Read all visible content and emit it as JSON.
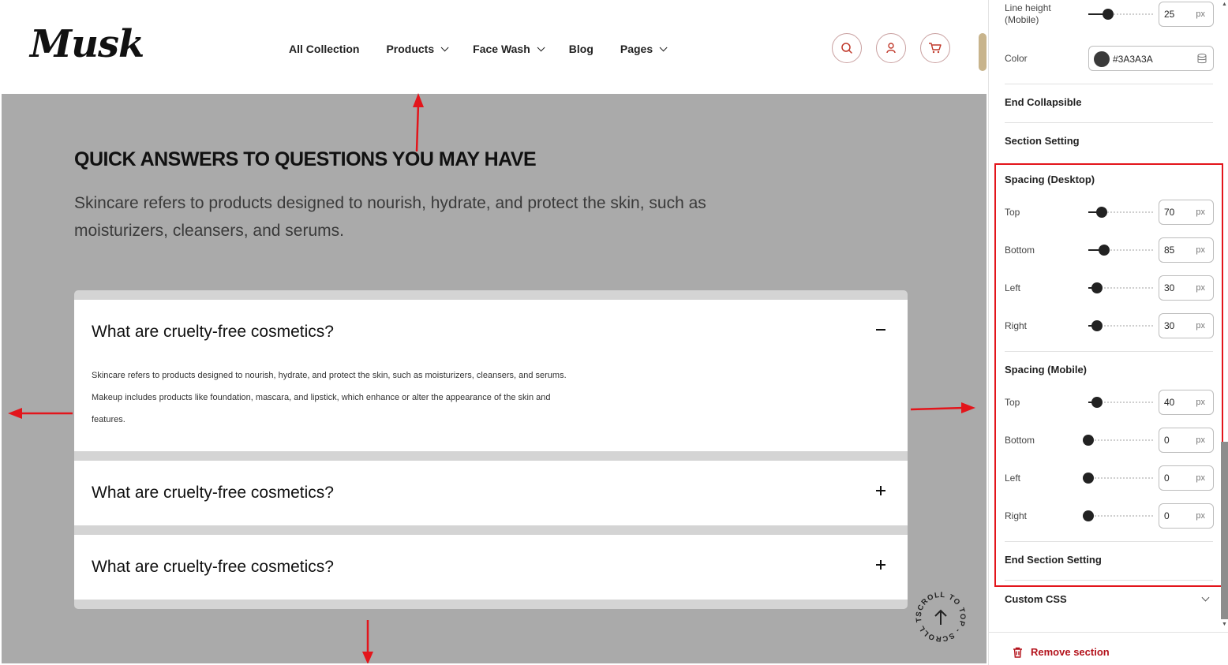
{
  "preview": {
    "header": {
      "logo": "Musk",
      "nav": [
        {
          "label": "All Collection",
          "has_dropdown": false
        },
        {
          "label": "Products",
          "has_dropdown": true
        },
        {
          "label": "Face Wash",
          "has_dropdown": true
        },
        {
          "label": "Blog",
          "has_dropdown": false
        },
        {
          "label": "Pages",
          "has_dropdown": true
        }
      ],
      "icons": [
        "search-icon",
        "user-icon",
        "cart-icon"
      ],
      "accent_color": "#c0392b"
    },
    "faq": {
      "title": "QUICK ANSWERS TO QUESTIONS YOU MAY HAVE",
      "description": "Skincare refers to products designed to nourish, hydrate, and protect the skin, such as moisturizers, cleansers, and serums.",
      "items": [
        {
          "question": "What are cruelty-free cosmetics?",
          "expanded": true,
          "answer_lines": [
            "Skincare refers to products designed to nourish, hydrate, and protect the skin, such as moisturizers, cleansers, and serums.",
            "Makeup includes products like foundation, mascara, and lipstick, which enhance or alter the appearance of the skin and",
            "features."
          ]
        },
        {
          "question": "What are cruelty-free cosmetics?",
          "expanded": false
        },
        {
          "question": "What are cruelty-free cosmetics?",
          "expanded": false
        }
      ]
    },
    "scroll_to_top_text": "SCROLL TO TOP - SCROLL TO TOP - ",
    "background_color": "#aaaaaa",
    "annotation_color": "#e3151b"
  },
  "panel": {
    "line_height_mobile": {
      "label_line1": "Line height",
      "label_line2": "(Mobile)",
      "value": "25",
      "unit": "px",
      "level": 0.3
    },
    "color": {
      "label": "Color",
      "value": "#3A3A3A",
      "swatch": "#3A3A3A"
    },
    "end_collapsible": "End Collapsible",
    "section_setting": "Section Setting",
    "spacing_desktop": {
      "heading": "Spacing (Desktop)",
      "rows": [
        {
          "label": "Top",
          "value": "70",
          "unit": "px",
          "level": 0.21
        },
        {
          "label": "Bottom",
          "value": "85",
          "unit": "px",
          "level": 0.24
        },
        {
          "label": "Left",
          "value": "30",
          "unit": "px",
          "level": 0.13
        },
        {
          "label": "Right",
          "value": "30",
          "unit": "px",
          "level": 0.13
        }
      ]
    },
    "spacing_mobile": {
      "heading": "Spacing (Mobile)",
      "rows": [
        {
          "label": "Top",
          "value": "40",
          "unit": "px",
          "level": 0.13
        },
        {
          "label": "Bottom",
          "value": "0",
          "unit": "px",
          "level": 0
        },
        {
          "label": "Left",
          "value": "0",
          "unit": "px",
          "level": 0
        },
        {
          "label": "Right",
          "value": "0",
          "unit": "px",
          "level": 0
        }
      ]
    },
    "end_section_setting": "End Section Setting",
    "custom_css": "Custom CSS",
    "remove_section": "Remove section"
  }
}
